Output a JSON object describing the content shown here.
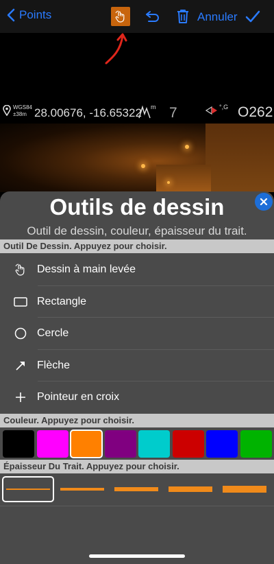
{
  "toolbar": {
    "back_label": "Points",
    "cancel_label": "Annuler",
    "icons": [
      "chevron-left-icon",
      "hand-draw-icon",
      "undo-icon",
      "trash-icon",
      "checkmark-icon"
    ],
    "accent_color": "#2a7bff",
    "active_tool_color": "#c8650d"
  },
  "annotation": {
    "arrow_color": "#e0261b"
  },
  "camera_info": {
    "datum": "WGS84",
    "accuracy": "±38m",
    "coordinates": "28.00676, -16.65322",
    "altitude_unit": "m",
    "satellites": "7",
    "compass_unit": "°,G",
    "heading": "O262"
  },
  "sheet": {
    "title": "Outils de dessin",
    "subtitle": "Outil de dessin, couleur, épaisseur du trait.",
    "tools_header": "Outil De Dessin. Appuyez pour choisir.",
    "tools": [
      {
        "label": "Dessin à main levée",
        "icon": "hand-draw-icon"
      },
      {
        "label": "Rectangle",
        "icon": "rectangle-icon"
      },
      {
        "label": "Cercle",
        "icon": "circle-icon"
      },
      {
        "label": "Flèche",
        "icon": "arrow-icon"
      },
      {
        "label": "Pointeur en croix",
        "icon": "crosshair-icon"
      }
    ],
    "colors_header": "Couleur. Appuyez pour choisir.",
    "colors": [
      "#000000",
      "#ff00ff",
      "#ff8000",
      "#800080",
      "#00cccc",
      "#cc0000",
      "#0000ff",
      "#00b300"
    ],
    "selected_color_index": 2,
    "stroke_header": "Épaisseur Du Trait. Appuyez pour choisir.",
    "stroke_widths": [
      2,
      4,
      6,
      8,
      10
    ],
    "selected_stroke_index": 0,
    "stroke_color": "#f08a1a"
  }
}
